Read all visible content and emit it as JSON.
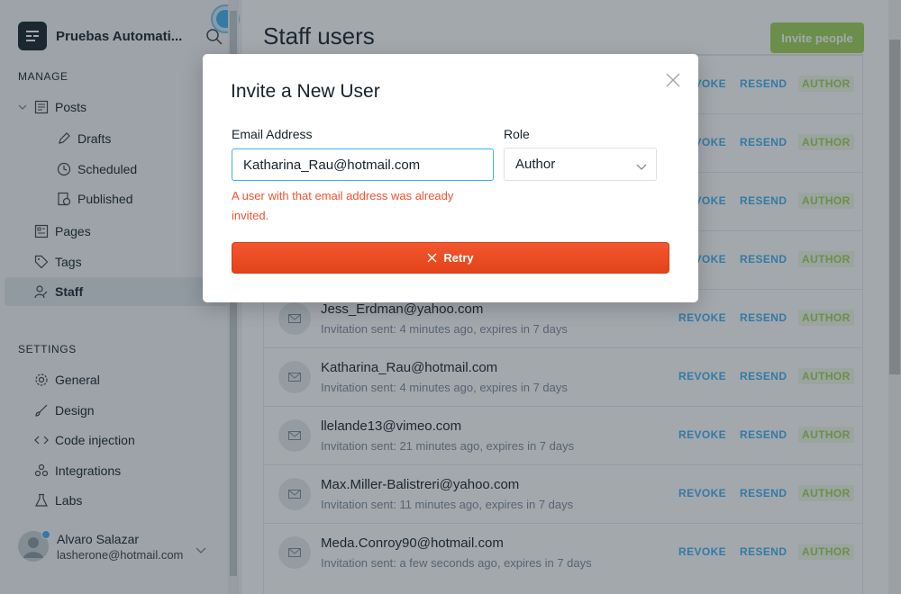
{
  "sidebar": {
    "brand_name": "Pruebas Automati...",
    "manage_title": "MANAGE",
    "settings_title": "SETTINGS",
    "items": {
      "posts": "Posts",
      "drafts": "Drafts",
      "scheduled": "Scheduled",
      "published": "Published",
      "pages": "Pages",
      "tags": "Tags",
      "staff": "Staff",
      "general": "General",
      "design": "Design",
      "code_injection": "Code injection",
      "integrations": "Integrations",
      "labs": "Labs"
    },
    "user": {
      "name": "Alvaro Salazar",
      "email": "lasherone@hotmail.com"
    }
  },
  "main": {
    "title": "Staff users",
    "invite_button": "Invite people",
    "actions": {
      "revoke": "REVOKE",
      "resend": "RESEND"
    },
    "invites": [
      {
        "email": "",
        "meta": "",
        "role": "AUTHOR"
      },
      {
        "email": "",
        "meta": "",
        "role": "AUTHOR"
      },
      {
        "email": "",
        "meta": "",
        "role": "AUTHOR"
      },
      {
        "email": "",
        "meta": "",
        "role": "AUTHOR"
      },
      {
        "email": "Jess_Erdman@yahoo.com",
        "meta": "Invitation sent: 4 minutes ago, expires in 7 days",
        "role": "AUTHOR"
      },
      {
        "email": "Katharina_Rau@hotmail.com",
        "meta": "Invitation sent: 4 minutes ago, expires in 7 days",
        "role": "AUTHOR"
      },
      {
        "email": "llelande13@vimeo.com",
        "meta": "Invitation sent: 21 minutes ago, expires in 7 days",
        "role": "AUTHOR"
      },
      {
        "email": "Max.Miller-Balistreri@yahoo.com",
        "meta": "Invitation sent: 11 minutes ago, expires in 7 days",
        "role": "AUTHOR"
      },
      {
        "email": "Meda.Conroy90@hotmail.com",
        "meta": "Invitation sent: a few seconds ago, expires in 7 days",
        "role": "AUTHOR"
      }
    ]
  },
  "modal": {
    "title": "Invite a New User",
    "email_label": "Email Address",
    "email_value": "Katharina_Rau@hotmail.com",
    "role_label": "Role",
    "role_value": "Author",
    "error": "A user with that email address was already invited.",
    "retry_button": "Retry"
  },
  "colors": {
    "accent_blue": "#3eb0ef",
    "green": "#9fd455",
    "error_red": "#f05230",
    "retry_red": "#e8481f"
  }
}
